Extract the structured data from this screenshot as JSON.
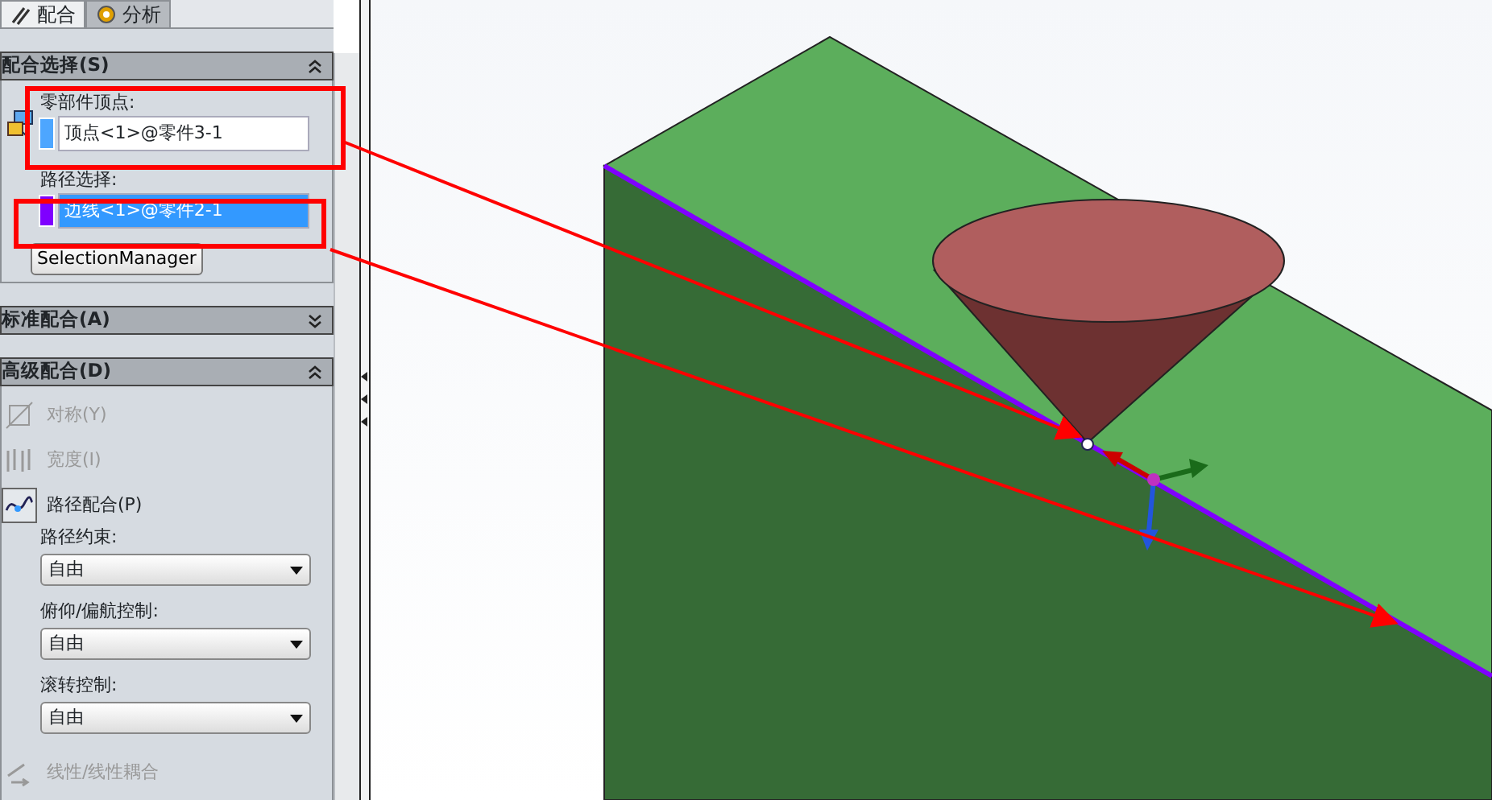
{
  "tabs": [
    {
      "label": "配合",
      "selected": true
    },
    {
      "label": "分析",
      "selected": false
    }
  ],
  "mate_selections": {
    "title": "配合选择(S)",
    "expanded": true,
    "fields": [
      {
        "label": "零部件顶点:",
        "value": "顶点<1>@零件3-1",
        "color": "#4da6ff",
        "selected": false
      },
      {
        "label": "路径选择:",
        "value": "边线<1>@零件2-1",
        "color": "#7f00ff",
        "selected": true
      }
    ],
    "button": "SelectionManager"
  },
  "standard_mates": {
    "title": "标准配合(A)",
    "expanded": false
  },
  "advanced_mates": {
    "title": "高级配合(D)",
    "expanded": true,
    "items": [
      {
        "kind": "mate",
        "label": "对称(Y)",
        "disabled": true,
        "selected": false
      },
      {
        "kind": "mate",
        "label": "宽度(I)",
        "disabled": true,
        "selected": false
      },
      {
        "kind": "mate",
        "label": "路径配合(P)",
        "disabled": false,
        "selected": true
      },
      {
        "kind": "dropdown",
        "label": "路径约束:",
        "value": "自由"
      },
      {
        "kind": "dropdown",
        "label": "俯仰/偏航控制:",
        "value": "自由"
      },
      {
        "kind": "dropdown",
        "label": "滚转控制:",
        "value": "自由"
      },
      {
        "kind": "mate",
        "label": "线性/线性耦合",
        "disabled": true,
        "selected": false
      }
    ]
  }
}
